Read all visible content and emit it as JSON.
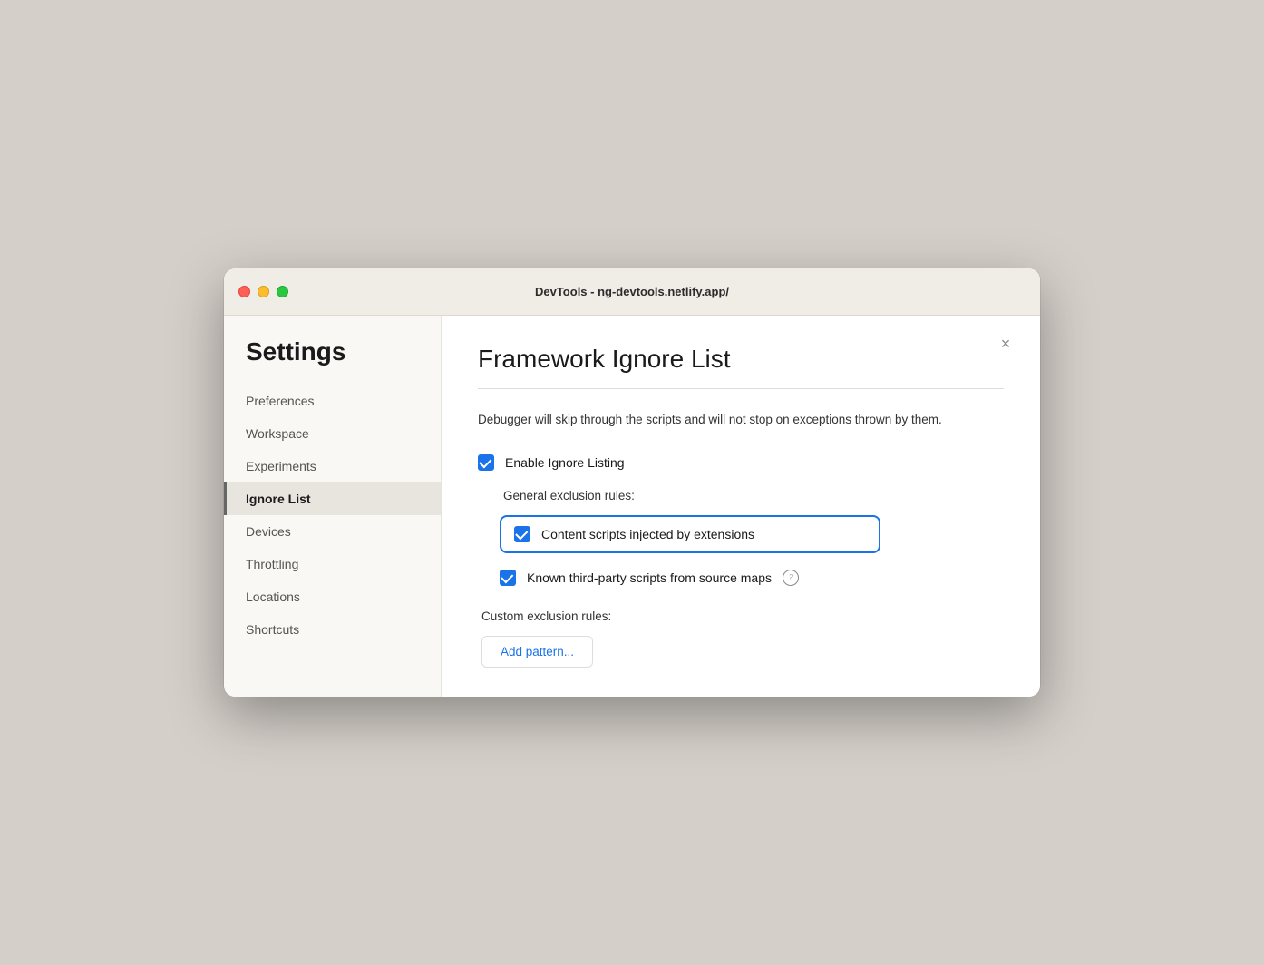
{
  "window": {
    "title": "DevTools - ng-devtools.netlify.app/"
  },
  "sidebar": {
    "heading": "Settings",
    "items": [
      {
        "id": "preferences",
        "label": "Preferences",
        "active": false
      },
      {
        "id": "workspace",
        "label": "Workspace",
        "active": false
      },
      {
        "id": "experiments",
        "label": "Experiments",
        "active": false
      },
      {
        "id": "ignore-list",
        "label": "Ignore List",
        "active": true
      },
      {
        "id": "devices",
        "label": "Devices",
        "active": false
      },
      {
        "id": "throttling",
        "label": "Throttling",
        "active": false
      },
      {
        "id": "locations",
        "label": "Locations",
        "active": false
      },
      {
        "id": "shortcuts",
        "label": "Shortcuts",
        "active": false
      }
    ]
  },
  "panel": {
    "title": "Framework Ignore List",
    "description": "Debugger will skip through the scripts and will not stop on\nexceptions thrown by them.",
    "close_label": "×",
    "enable_ignore_label": "Enable Ignore Listing",
    "general_exclusion_label": "General exclusion rules:",
    "rule1_label": "Content scripts injected by extensions",
    "rule2_label": "Known third-party scripts from source maps",
    "custom_exclusion_label": "Custom exclusion rules:",
    "add_pattern_label": "Add pattern...",
    "help_icon_label": "?"
  }
}
